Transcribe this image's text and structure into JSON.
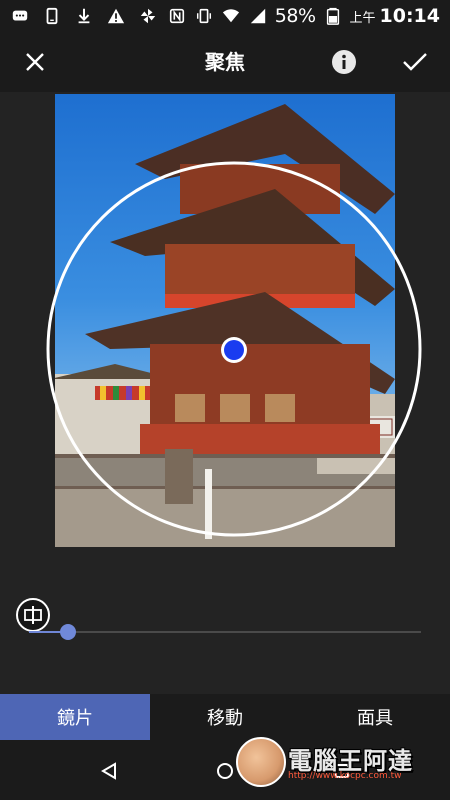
{
  "status_bar": {
    "battery": "58%",
    "clock_prefix": "上午",
    "clock": "10:14",
    "left_icons": [
      "message-icon",
      "phone-icon",
      "download-icon",
      "warning-icon",
      "pinwheel-icon"
    ],
    "right_icons": [
      "nfc-icon",
      "vibrate-icon",
      "wifi-icon",
      "signal-icon",
      "battery-icon"
    ]
  },
  "top_bar": {
    "title": "聚焦",
    "close_icon": "close-icon",
    "info_icon": "info-icon",
    "check_icon": "check-icon"
  },
  "editor": {
    "photo_subject": "pagoda photo",
    "focus_tool": "circular focus selector",
    "compare_icon": "compare-icon"
  },
  "slider": {
    "value": 0.1
  },
  "tabs": [
    {
      "label": "鏡片",
      "active": true
    },
    {
      "label": "移動",
      "active": false
    },
    {
      "label": "面具",
      "active": false
    }
  ],
  "nav": {
    "back_icon": "back-icon",
    "home_icon": "home-icon",
    "recent_icon": "recent-apps-icon"
  },
  "watermark": {
    "title": "電腦王阿達",
    "url": "http://www.kocpc.com.tw"
  },
  "colors": {
    "accent": "#4e66b5",
    "focus_dot": "#1a3cf0",
    "background": "#1f1f1f"
  }
}
